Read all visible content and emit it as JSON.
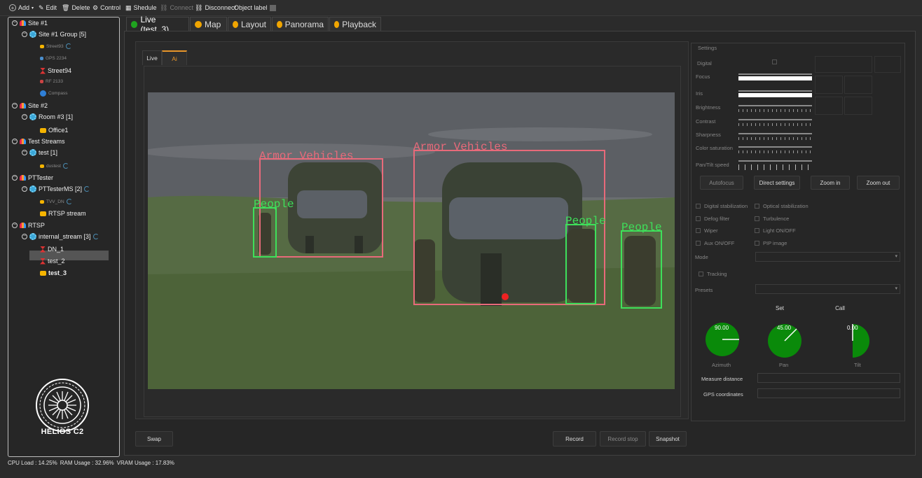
{
  "toolbar": {
    "add": "Add",
    "edit": "Edit",
    "delete": "Delete",
    "control": "Control",
    "schedule": "Shedule",
    "connect": "Connect",
    "disconnect": "Disconnect",
    "object_label": "Object label"
  },
  "tree": {
    "site1": "Site #1",
    "site1_group": "Site #1 Group [5]",
    "street93": "Street93",
    "gps2234": "GPS 2234",
    "street94": "Street94",
    "rf2133": "RF 2133",
    "compass": "Compass",
    "site2": "Site #2",
    "room3": "Room #3 [1]",
    "office1": "Office1",
    "test_streams": "Test Streams",
    "test_group": "test [1]",
    "dustest": "dustest",
    "pttester": "PTTester",
    "pttesterms": "PTTesterMS [2]",
    "tvv_dn": "TVV_DN",
    "rtsp_stream": "RTSP stream",
    "rtsp": "RTSP",
    "internal_stream": "internal_stream [3]",
    "dn1": "DN_1",
    "test2": "test_2",
    "test3": "test_3"
  },
  "brand": "HELIOS C2",
  "tabs": [
    {
      "label": "Live (test_3)",
      "color": "#1fa31f"
    },
    {
      "label": "Map",
      "color": "#f0a500"
    },
    {
      "label": "Layout",
      "color": "#f0a500"
    },
    {
      "label": "Panorama",
      "color": "#f0a500"
    },
    {
      "label": "Playback",
      "color": "#f0a500"
    }
  ],
  "subtabs": {
    "live": "Live",
    "ai": "Ai"
  },
  "detections": {
    "armor": "Armor Vehicles",
    "people": "People",
    "armor_color": "#e86a7a",
    "people_color": "#3ee05a"
  },
  "buttons": {
    "swap": "Swap",
    "record": "Record",
    "record_stop": "Record stop",
    "snapshot": "Snapshot"
  },
  "settings": {
    "title": "Settings",
    "digital": "Digital",
    "focus": "Focus",
    "iris": "Iris",
    "brightness": "Brightness",
    "contrast": "Contrast",
    "sharpness": "Sharpness",
    "color_saturation": "Color saturation",
    "pan_tilt_speed": "Pan/Tilt speed",
    "autofocus": "Autofocus",
    "direct_settings": "Direct settings",
    "zoom_in": "Zoom in",
    "zoom_out": "Zoom out",
    "digital_stab": "Digital stabilization",
    "optical_stab": "Optical stabilization",
    "defog": "Defog filter",
    "turbulence": "Turbulence",
    "wiper": "Wiper",
    "light": "Light ON/OFF",
    "aux": "Aux ON/OFF",
    "pip": "PIP image",
    "mode": "Mode",
    "tracking": "Tracking",
    "presets": "Presets",
    "set": "Set",
    "call": "Call",
    "azimuth_value": "90.00",
    "pan_value": "45.00",
    "tilt_value": "0.00",
    "azimuth": "Azimuth",
    "pan": "Pan",
    "tilt": "Tilt",
    "measure_distance": "Measure distance",
    "gps_coordinates": "GPS coordinates",
    "gauge_color": "#0a8a0a"
  },
  "status": {
    "cpu": "CPU Load : 14.25%",
    "ram": "RAM Usage : 32.96%",
    "vram": "VRAM Usage : 17.83%"
  }
}
